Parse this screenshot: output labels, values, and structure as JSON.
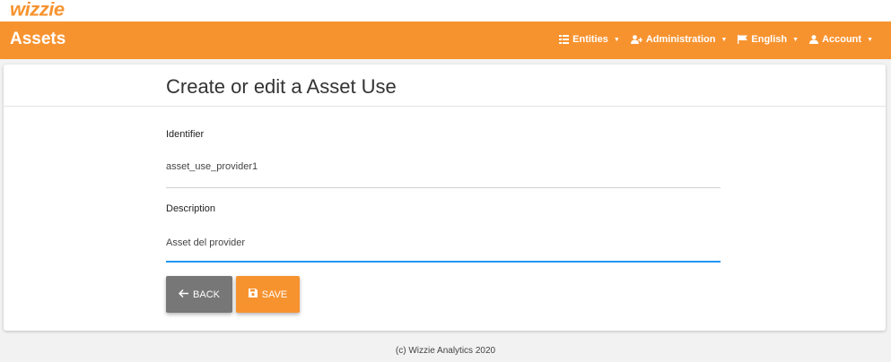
{
  "logo": {
    "text": "wizzie"
  },
  "navbar": {
    "brand": "Assets",
    "items": [
      {
        "label": "Entities",
        "icon": "list-icon"
      },
      {
        "label": "Administration",
        "icon": "user-plus-icon"
      },
      {
        "label": "English",
        "icon": "flag-icon"
      },
      {
        "label": "Account",
        "icon": "user-icon"
      }
    ]
  },
  "form": {
    "title": "Create or edit a Asset Use",
    "identifier_label": "Identifier",
    "identifier_value": "asset_use_provider1",
    "description_label": "Description",
    "description_value": "Asset del provider",
    "back_label": "BACK",
    "save_label": "SAVE"
  },
  "footer": {
    "text": "(c) Wizzie Analytics 2020"
  },
  "colors": {
    "accent": "#f7932f",
    "focus": "#2196f3",
    "back_button": "#777777"
  }
}
